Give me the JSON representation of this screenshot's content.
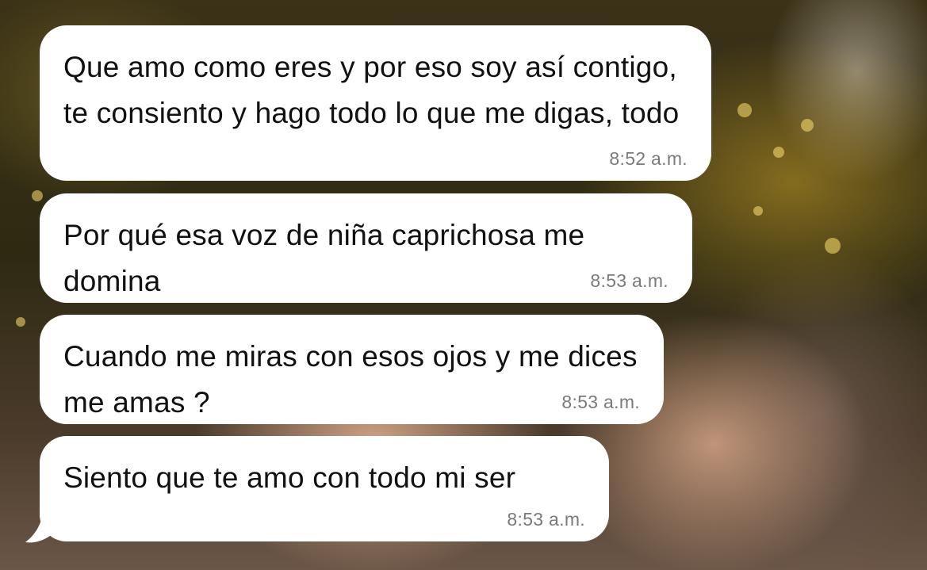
{
  "chat": {
    "messages": [
      {
        "text": "Que amo como eres y por eso soy así contigo, te consiento y hago todo lo que me digas, todo",
        "time": "8:52 a.m."
      },
      {
        "text": "Por qué esa voz de niña caprichosa me domina",
        "time": "8:53 a.m."
      },
      {
        "text": "Cuando me miras con esos ojos y me dices me amas ?",
        "time": "8:53 a.m."
      },
      {
        "text": "Siento que te amo con todo mi ser",
        "time": "8:53 a.m."
      }
    ]
  },
  "colors": {
    "bubble": "#ffffff",
    "text": "#111111",
    "timestamp": "#7a7a7a"
  },
  "icons": {
    "bubble_tail": "incoming-bubble-tail-icon"
  }
}
